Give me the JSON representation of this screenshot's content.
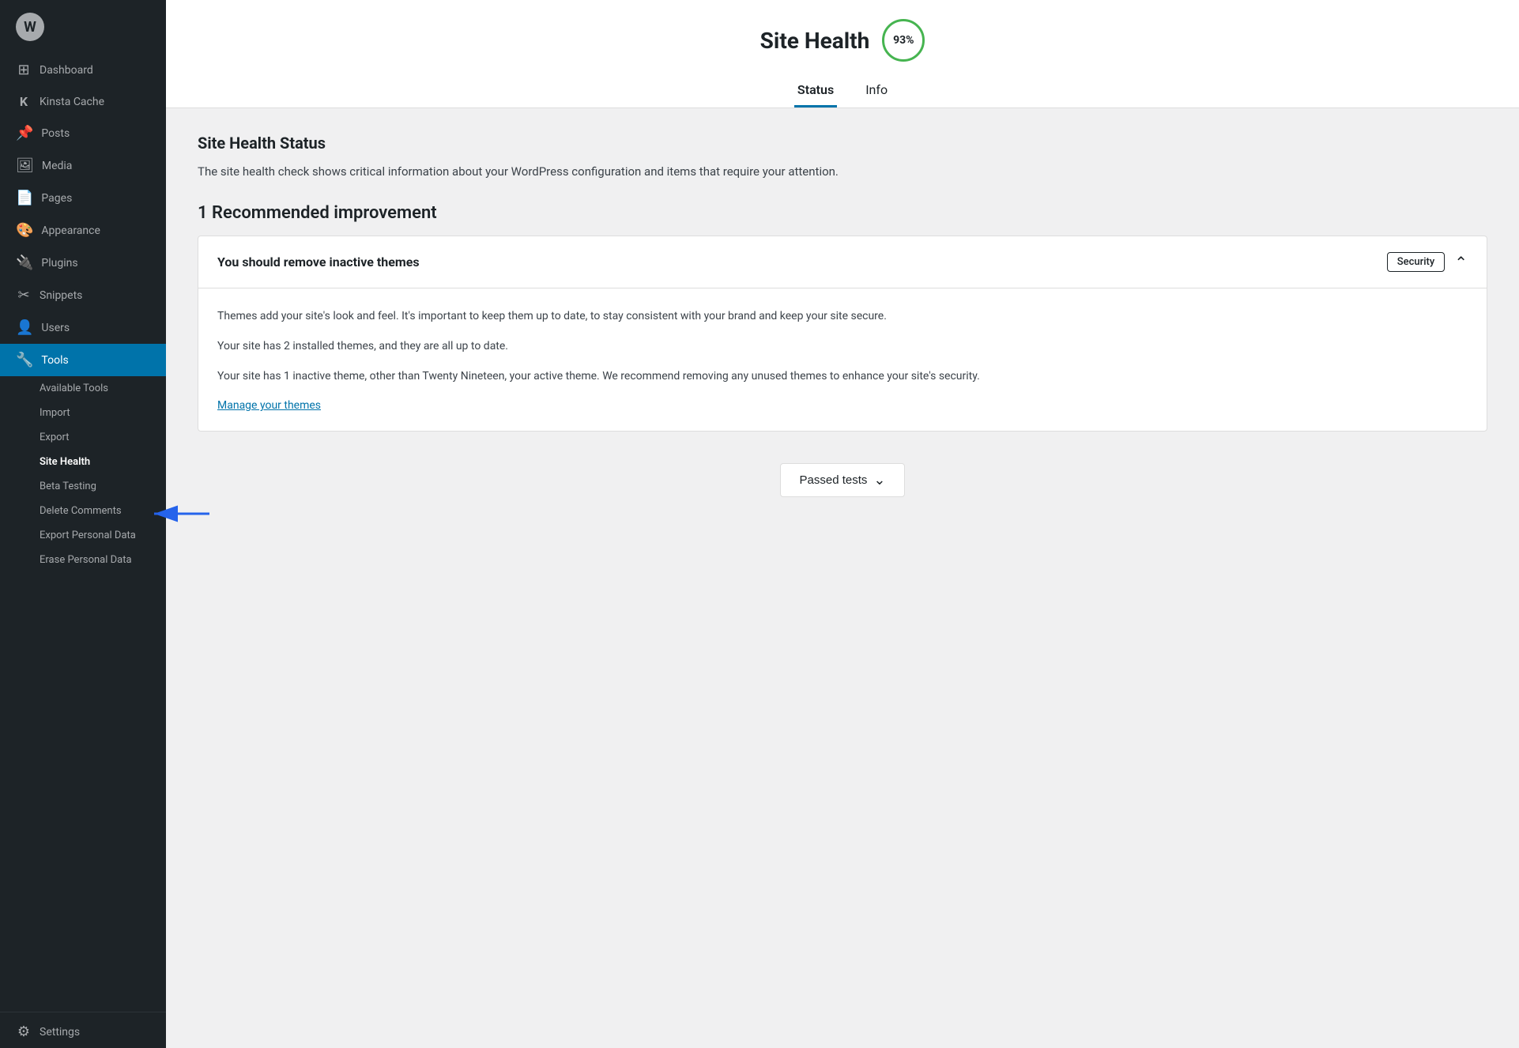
{
  "sidebar": {
    "items": [
      {
        "id": "dashboard",
        "label": "Dashboard",
        "icon": "⊞"
      },
      {
        "id": "kinsta-cache",
        "label": "Kinsta Cache",
        "icon": "K"
      },
      {
        "id": "posts",
        "label": "Posts",
        "icon": "📌"
      },
      {
        "id": "media",
        "label": "Media",
        "icon": "🖼"
      },
      {
        "id": "pages",
        "label": "Pages",
        "icon": "📄"
      },
      {
        "id": "appearance",
        "label": "Appearance",
        "icon": "🎨"
      },
      {
        "id": "plugins",
        "label": "Plugins",
        "icon": "🔌"
      },
      {
        "id": "snippets",
        "label": "Snippets",
        "icon": "✂"
      },
      {
        "id": "users",
        "label": "Users",
        "icon": "👤"
      },
      {
        "id": "tools",
        "label": "Tools",
        "icon": "🔧",
        "active": true
      }
    ],
    "sub_items": [
      {
        "id": "available-tools",
        "label": "Available Tools"
      },
      {
        "id": "import",
        "label": "Import"
      },
      {
        "id": "export",
        "label": "Export"
      },
      {
        "id": "site-health",
        "label": "Site Health",
        "active": true
      },
      {
        "id": "beta-testing",
        "label": "Beta Testing"
      },
      {
        "id": "delete-comments",
        "label": "Delete Comments"
      },
      {
        "id": "export-personal-data",
        "label": "Export Personal Data"
      },
      {
        "id": "erase-personal-data",
        "label": "Erase Personal Data"
      }
    ],
    "settings_item": {
      "id": "settings",
      "label": "Settings",
      "icon": "⚙"
    }
  },
  "header": {
    "title": "Site Health",
    "score": "93%",
    "tabs": [
      {
        "id": "status",
        "label": "Status",
        "active": true
      },
      {
        "id": "info",
        "label": "Info"
      }
    ]
  },
  "content": {
    "section_title": "Site Health Status",
    "section_description": "The site health check shows critical information about your WordPress configuration and items that require your attention.",
    "recommendation_count": "1 Recommended improvement",
    "issue": {
      "title": "You should remove inactive themes",
      "badge": "Security",
      "body_paragraphs": [
        "Themes add your site's look and feel. It's important to keep them up to date, to stay consistent with your brand and keep your site secure.",
        "Your site has 2 installed themes, and they are all up to date.",
        "Your site has 1 inactive theme, other than Twenty Nineteen, your active theme. We recommend removing any unused themes to enhance your site's security."
      ],
      "link_text": "Manage your themes",
      "link_href": "#"
    }
  },
  "passed_tests": {
    "button_label": "Passed tests",
    "chevron": "∨"
  }
}
